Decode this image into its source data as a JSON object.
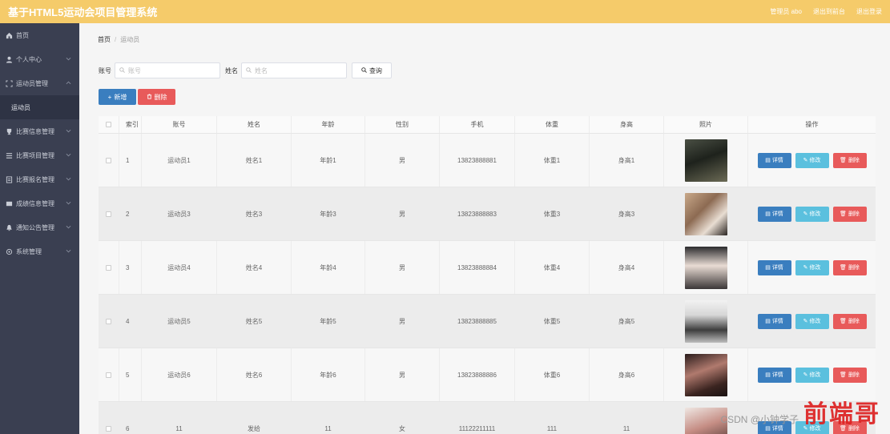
{
  "app": {
    "title": "基于HTML5运动会项目管理系统"
  },
  "topbar": {
    "user": "管理员 abo",
    "back": "退出到前台",
    "logout": "退出登录"
  },
  "sidebar": {
    "items": [
      {
        "label": "首页",
        "icon": "home-icon"
      },
      {
        "label": "个人中心",
        "icon": "user-icon"
      },
      {
        "label": "运动员管理",
        "icon": "expand-icon"
      },
      {
        "label": "比赛信息管理",
        "icon": "cup-icon"
      },
      {
        "label": "比赛项目管理",
        "icon": "list-icon"
      },
      {
        "label": "比赛报名管理",
        "icon": "form-icon"
      },
      {
        "label": "成绩信息管理",
        "icon": "score-icon"
      },
      {
        "label": "通知公告管理",
        "icon": "bell-icon"
      },
      {
        "label": "系统管理",
        "icon": "gear-icon"
      }
    ],
    "sub_item": "运动员"
  },
  "breadcrumb": {
    "home": "首页",
    "current": "运动员"
  },
  "search": {
    "account_label": "账号",
    "account_placeholder": "账号",
    "name_label": "姓名",
    "name_placeholder": "姓名",
    "query_label": "查询"
  },
  "actions": {
    "add": "新增",
    "delete": "删除"
  },
  "table": {
    "headers": [
      "索引",
      "账号",
      "姓名",
      "年龄",
      "性别",
      "手机",
      "体重",
      "身高",
      "照片",
      "操作"
    ],
    "rows": [
      {
        "index": "1",
        "account": "运动员1",
        "name": "姓名1",
        "age": "年龄1",
        "gender": "男",
        "phone": "13823888881",
        "weight": "体重1",
        "height": "身高1"
      },
      {
        "index": "2",
        "account": "运动员3",
        "name": "姓名3",
        "age": "年龄3",
        "gender": "男",
        "phone": "13823888883",
        "weight": "体重3",
        "height": "身高3"
      },
      {
        "index": "3",
        "account": "运动员4",
        "name": "姓名4",
        "age": "年龄4",
        "gender": "男",
        "phone": "13823888884",
        "weight": "体重4",
        "height": "身高4"
      },
      {
        "index": "4",
        "account": "运动员5",
        "name": "姓名5",
        "age": "年龄5",
        "gender": "男",
        "phone": "13823888885",
        "weight": "体重5",
        "height": "身高5"
      },
      {
        "index": "5",
        "account": "运动员6",
        "name": "姓名6",
        "age": "年龄6",
        "gender": "男",
        "phone": "13823888886",
        "weight": "体重6",
        "height": "身高6"
      },
      {
        "index": "6",
        "account": "11",
        "name": "发给",
        "age": "11",
        "gender": "女",
        "phone": "11122211111",
        "weight": "111",
        "height": "11"
      }
    ],
    "op_detail": "详情",
    "op_edit": "修改",
    "op_delete": "删除"
  },
  "watermark": {
    "text": "前端哥",
    "csdn": "CSDN @小钟学子"
  },
  "colors": {
    "topbar": "#f5cb6a",
    "sidebar": "#3a3f51",
    "primary": "#3a7ebf",
    "info": "#5bc0de",
    "danger": "#e85a5a"
  }
}
